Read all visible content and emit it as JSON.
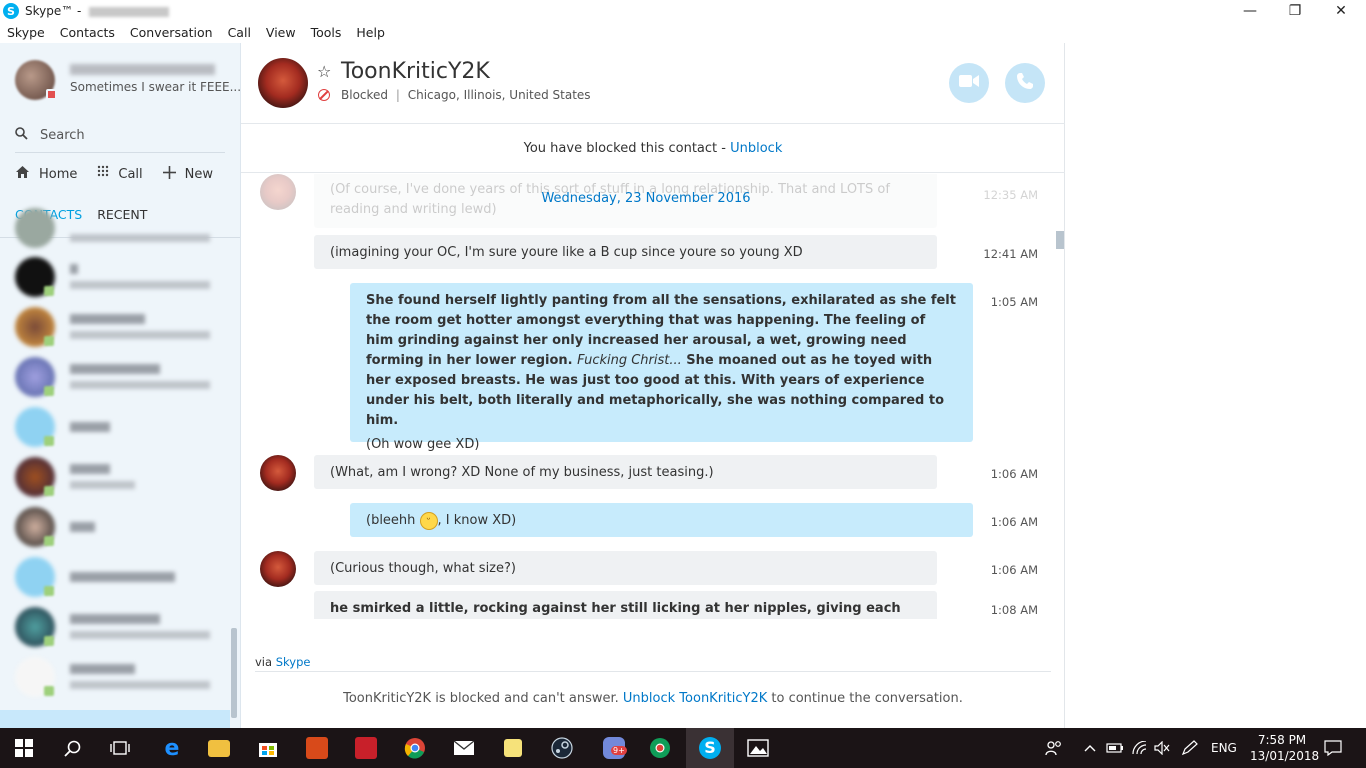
{
  "window": {
    "title": "Skype™ - ",
    "app_icon": "S",
    "controls": {
      "minimize": "—",
      "maximize": "❐",
      "close": "✕"
    }
  },
  "menu": [
    "Skype",
    "Contacts",
    "Conversation",
    "Call",
    "View",
    "Tools",
    "Help"
  ],
  "profile": {
    "mood": "Sometimes I swear it FEEE..."
  },
  "sidebar": {
    "search_placeholder": "Search",
    "nav": {
      "home": "Home",
      "call": "Call",
      "new": "New"
    },
    "tabs": {
      "contacts": "CONTACTS",
      "recent": "RECENT"
    }
  },
  "chat": {
    "contact_name": "ToonKriticY2K",
    "status": "Blocked",
    "location": "Chicago, Illinois, United States",
    "blocked_notice": "You have blocked this contact - ",
    "unblock_link": "Unblock",
    "date_separator": "Wednesday, 23 November 2016",
    "faded_message": "(Of course, I've done years of this sort of stuff in a long relationship. That and LOTS of reading and writing lewd)",
    "faded_time": "12:35 AM",
    "messages": [
      {
        "from": "contact",
        "text": "(imagining your OC, I'm sure youre like a B cup since youre so young XD",
        "time": "12:41 AM"
      },
      {
        "from": "me",
        "text_bold": "She found herself lightly panting from all the sensations, exhilarated as she felt the room get hotter amongst everything that was happening. The feeling of him grinding against her only increased her arousal, a wet, growing need forming in her lower region. ",
        "text_italic": "Fucking Christ...",
        "text_bold2": " She moaned out as he toyed with her exposed breasts. He was just too good at this. With years of experience under his belt, both literally and metaphorically, she was nothing compared to him.",
        "text_plain": "(Oh wow gee XD)",
        "time": "1:05 AM"
      },
      {
        "from": "contact",
        "text": "(What, am I wrong? XD None of my business, just teasing.)",
        "time": "1:06 AM"
      },
      {
        "from": "me",
        "text_before": "(bleehh ",
        "text_after": ", I know XD)",
        "time": "1:06 AM"
      },
      {
        "from": "contact",
        "text": "(Curious though, what size?)",
        "time": "1:06 AM"
      },
      {
        "from": "contact",
        "text": "he smirked a little, rocking against her still licking at her nipples, giving each one",
        "time": "1:08 AM"
      }
    ],
    "via_label": "via ",
    "via_link": "Skype",
    "footer_text_1": "ToonKriticY2K is blocked and can't answer. ",
    "footer_link": "Unblock ToonKriticY2K",
    "footer_text_2": " to continue the conversation."
  },
  "taskbar": {
    "language": "ENG",
    "time": "7:58 PM",
    "date": "13/01/2018",
    "notification_badge": "9+"
  },
  "colors": {
    "accent": "#00aff0",
    "link": "#0078c8",
    "my_bubble": "#c7ebfc",
    "their_bubble": "#eff1f3",
    "blocked_red": "#e04040"
  }
}
